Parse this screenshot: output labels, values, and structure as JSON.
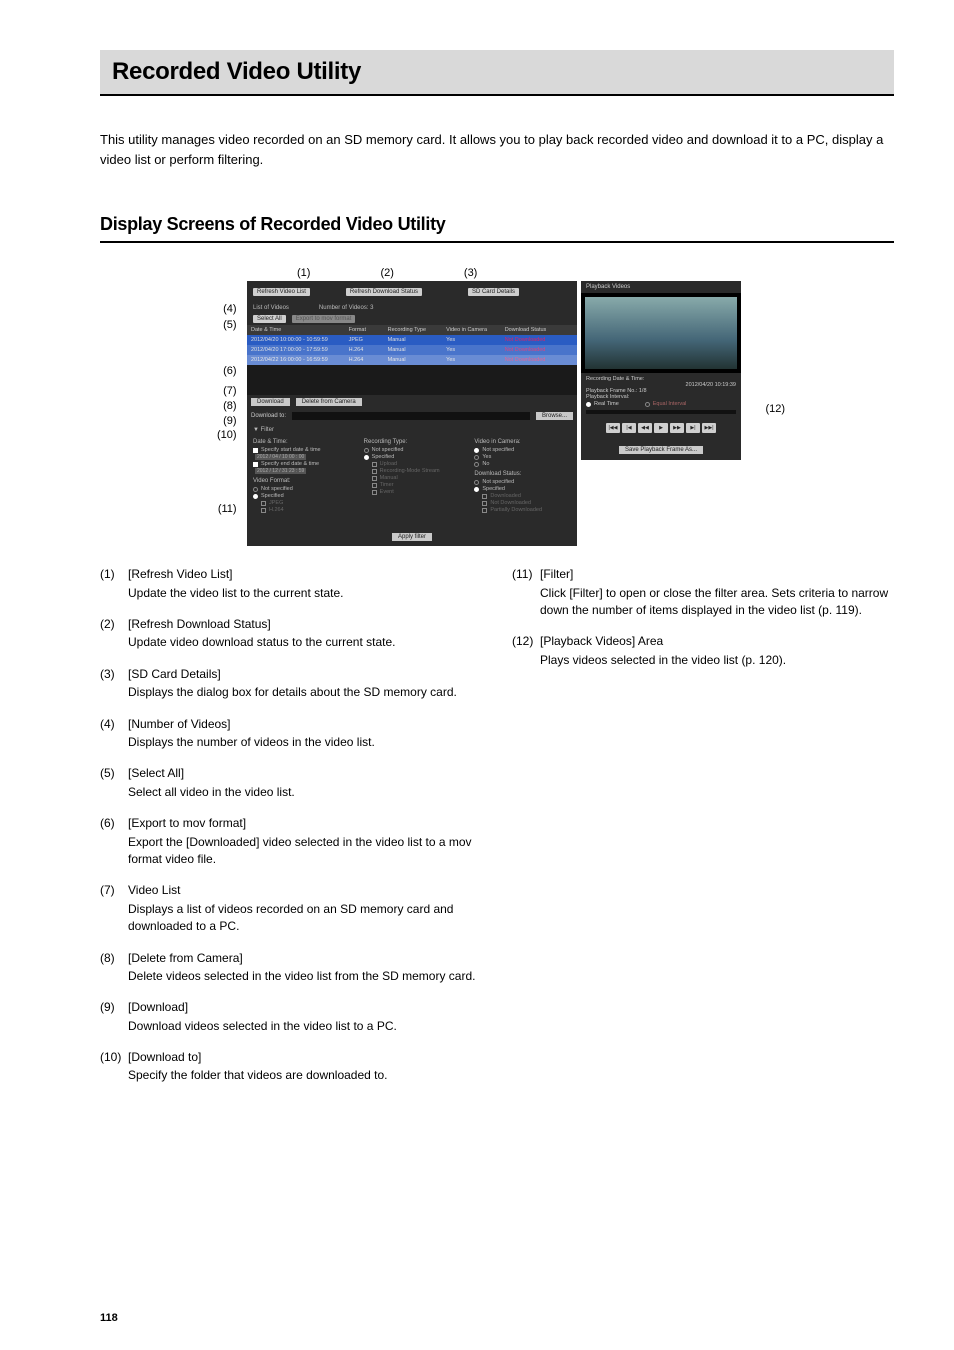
{
  "page_number": "118",
  "title": "Recorded Video Utility",
  "intro": "This utility manages video recorded on an SD memory card. It allows you to play back recorded video and download it to a PC, display a video list or perform filtering.",
  "section_heading": "Display Screens of Recorded Video Utility",
  "callouts": [
    "(1)",
    "(2)",
    "(3)",
    "(4)",
    "(5)",
    "(6)",
    "(7)",
    "(8)",
    "(9)",
    "(10)",
    "(11)",
    "(12)"
  ],
  "shot": {
    "top_buttons": [
      "Refresh Video List",
      "Refresh Download Status",
      "SD Card Details"
    ],
    "list_label": "List of Videos",
    "count_label": "Number of Videos: 3",
    "select_all": "Select All",
    "export": "Export to mov format",
    "columns": [
      "Date & Time",
      "Format",
      "Recording Type",
      "Video in Camera",
      "Download Status"
    ],
    "rows": [
      [
        "2012/04/20 10:00:00 - 10:59:59",
        "JPEG",
        "Manual",
        "Yes",
        "Not Downloaded"
      ],
      [
        "2012/04/20 17:00:00 - 17:59:59",
        "H.264",
        "Manual",
        "Yes",
        "Not Downloaded"
      ],
      [
        "2012/04/22 16:00:00 - 16:59:59",
        "H.264",
        "Manual",
        "Yes",
        "Not Downloaded"
      ]
    ],
    "download": "Download",
    "delete": "Delete from Camera",
    "download_to": "Download to:",
    "browse": "Browse...",
    "filter_toggle": "▼ Filter",
    "filter": {
      "dt_label": "Date & Time:",
      "start_chk": "Specify start date & time",
      "start_val": "2012 / 04 / 10  00 : 00",
      "end_chk": "Specify end date & time",
      "end_val": "2012 / 12 / 31  23 : 59",
      "vf_label": "Video Format:",
      "ns": "Not specified",
      "spec": "Specified",
      "jpeg": "JPEG",
      "h264": "H.264",
      "rt_label": "Recording Type:",
      "upload": "Upload",
      "rms": "Recording-Mode Stream",
      "manual": "Manual",
      "timer": "Timer",
      "event": "Event",
      "vic_label": "Video in Camera:",
      "yes": "Yes",
      "no": "No",
      "ds_label": "Download Status:",
      "dl": "Downloaded",
      "ndl": "Not Downloaded",
      "pdl": "Partially Downloaded",
      "apply": "Apply filter"
    },
    "pb": {
      "title": "Playback Videos",
      "rec_dt_label": "Recording Date & Time:",
      "rec_dt": "2012/04/20 10:19:39",
      "frame_label": "Playback Frame No.: 1/8",
      "int_label": "Playback Interval:",
      "rt": "Real Time",
      "eq": "Equal Interval",
      "save": "Save Playback Frame As..."
    }
  },
  "left_items": [
    {
      "n": "(1)",
      "t": "[Refresh Video List]",
      "d": "Update the video list to the current state."
    },
    {
      "n": "(2)",
      "t": "[Refresh Download Status]",
      "d": "Update video download status to the current state."
    },
    {
      "n": "(3)",
      "t": "[SD Card Details]",
      "d": "Displays the dialog box for details about the SD memory card."
    },
    {
      "n": "(4)",
      "t": "[Number of Videos]",
      "d": "Displays the number of videos in the video list."
    },
    {
      "n": "(5)",
      "t": "[Select All]",
      "d": "Select all video in the video list."
    },
    {
      "n": "(6)",
      "t": "[Export to mov format]",
      "d": "Export the [Downloaded] video selected in the video list to a mov format video file."
    },
    {
      "n": "(7)",
      "t": "Video List",
      "d": "Displays a list of videos recorded on an SD memory card and downloaded to a PC."
    },
    {
      "n": "(8)",
      "t": "[Delete from Camera]",
      "d": "Delete videos selected in the video list from the SD memory card."
    },
    {
      "n": "(9)",
      "t": "[Download]",
      "d": "Download videos selected in the video list to a PC."
    },
    {
      "n": "(10)",
      "t": "[Download to]",
      "d": "Specify the folder that videos are downloaded to."
    }
  ],
  "right_items": [
    {
      "n": "(11)",
      "t": "[Filter]",
      "d": "Click [Filter] to open or close the filter area. Sets criteria to narrow down the number of items displayed in the video list (p. 119)."
    },
    {
      "n": "(12)",
      "t": "[Playback Videos] Area",
      "d": "Plays videos selected in the video list (p. 120)."
    }
  ]
}
